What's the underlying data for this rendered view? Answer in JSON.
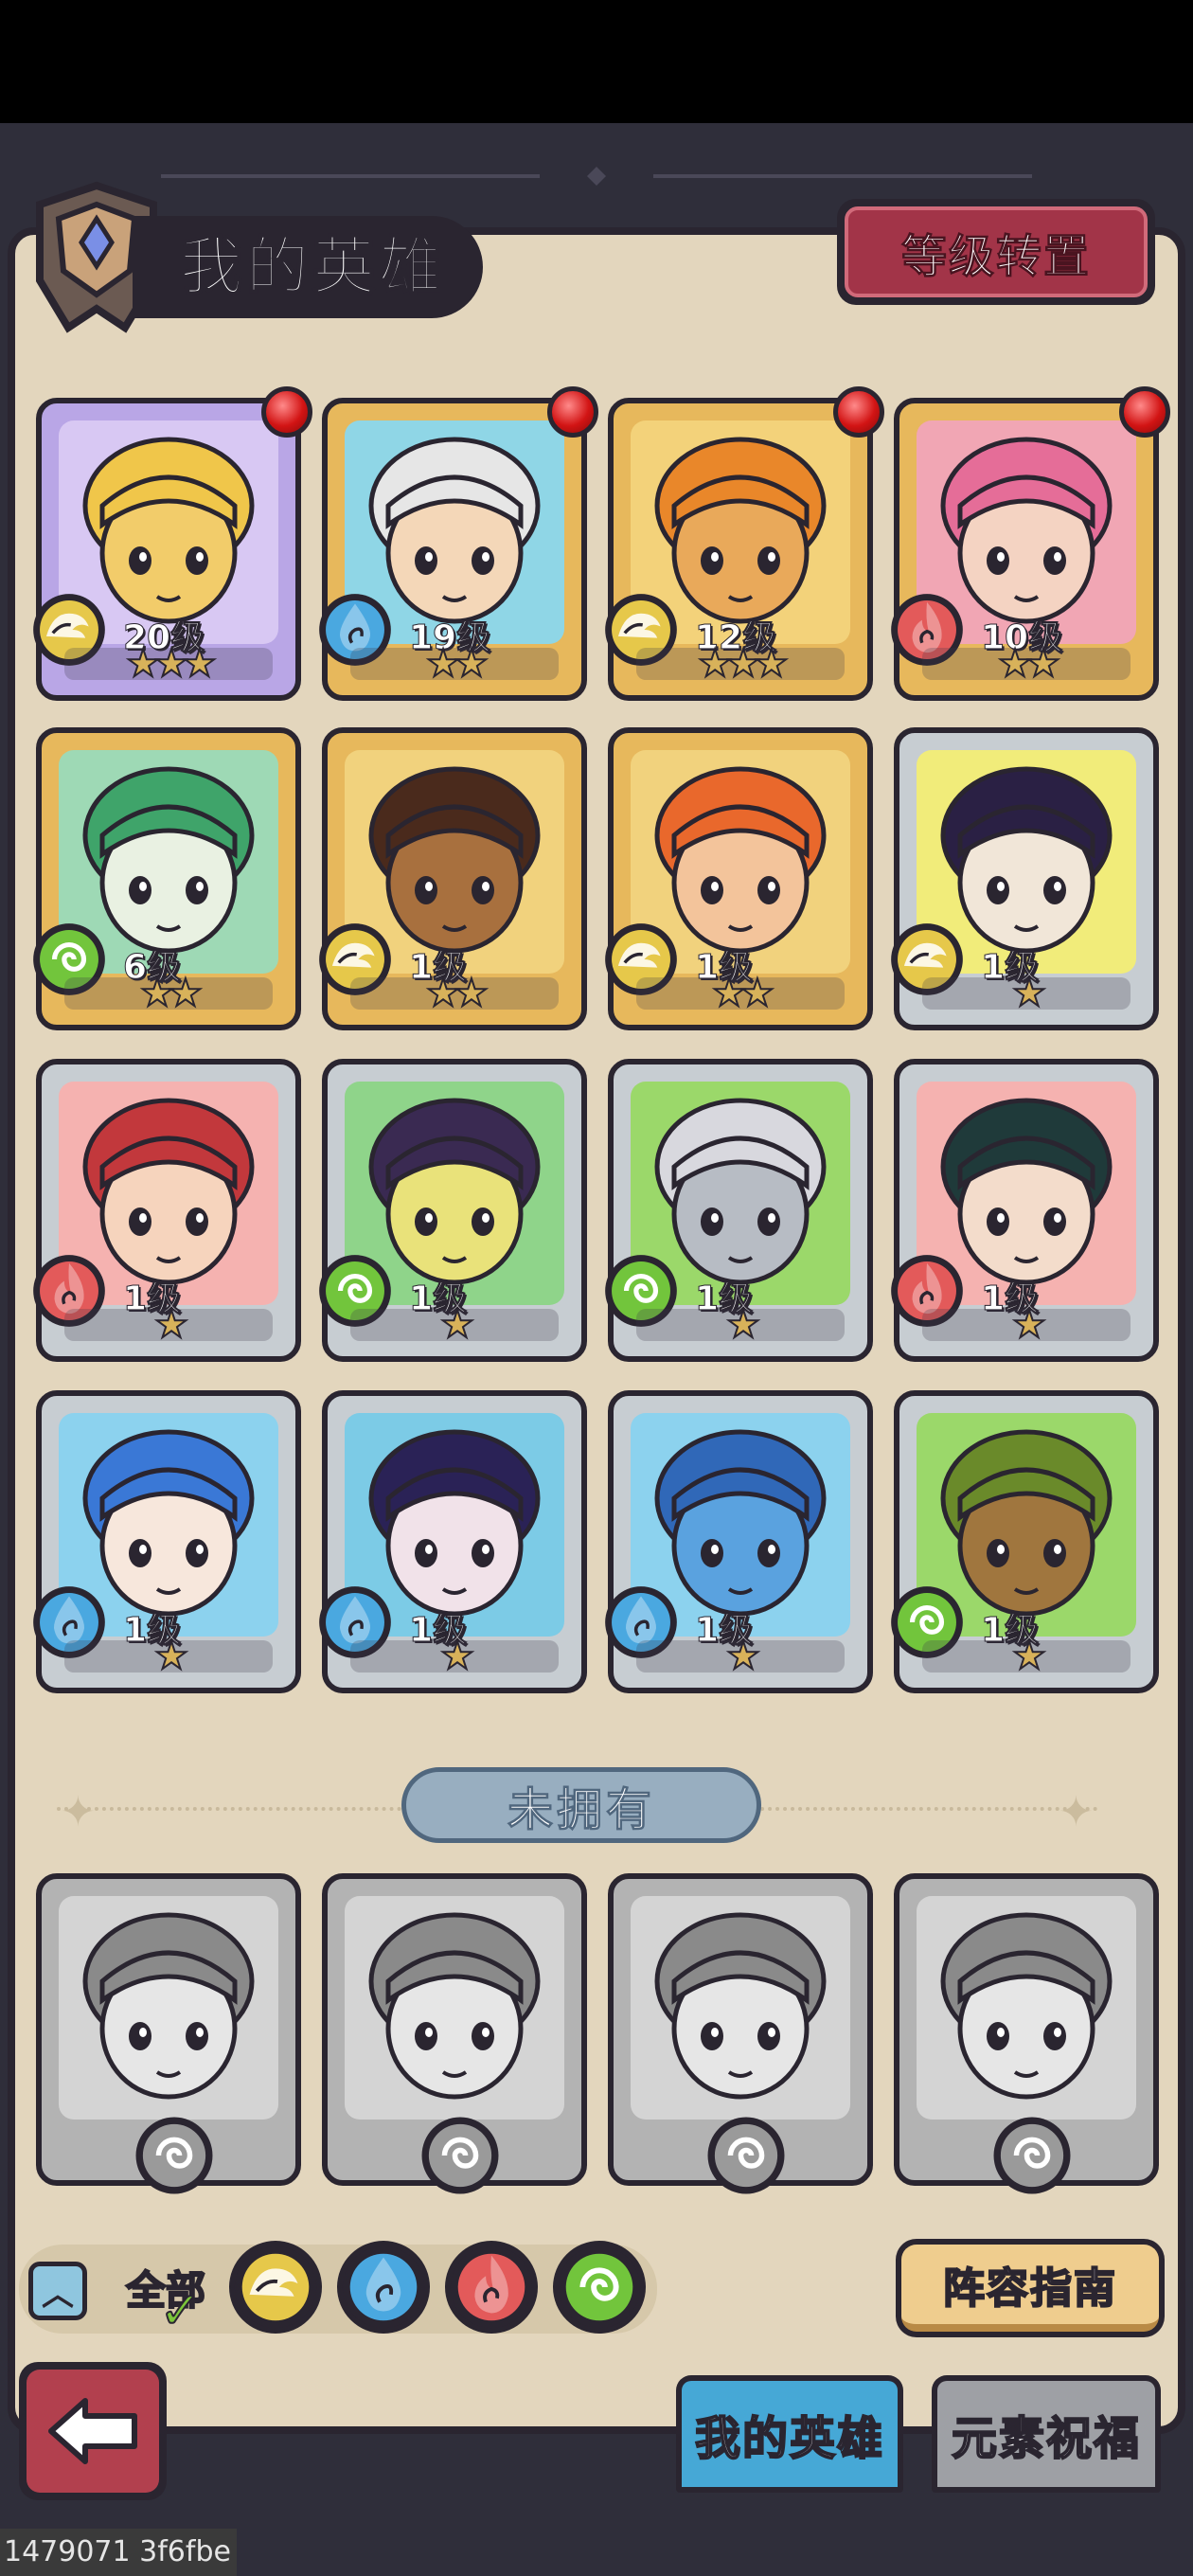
{
  "header": {
    "title": "我的英雄",
    "transfer_button": "等级转置"
  },
  "owned_heroes": [
    {
      "level": "20级",
      "stars": "★★★",
      "element": "earth",
      "tier": "purple",
      "notify": true,
      "skin": "#f2cc6a",
      "hair": "#f0c64a",
      "bg": "#d8c8f3"
    },
    {
      "level": "19级",
      "stars": "★★",
      "element": "water",
      "tier": "gold",
      "notify": true,
      "skin": "#f4d7b8",
      "hair": "#e6e6e6",
      "bg": "#8fd6e6"
    },
    {
      "level": "12级",
      "stars": "★★★",
      "element": "earth",
      "tier": "gold",
      "notify": true,
      "skin": "#e9a95a",
      "hair": "#e9872a",
      "bg": "#f3d27a"
    },
    {
      "level": "10级",
      "stars": "★★",
      "element": "fire",
      "tier": "gold",
      "notify": true,
      "skin": "#f4d3c2",
      "hair": "#e56d98",
      "bg": "#f1a6b4"
    },
    {
      "level": "6级",
      "stars": "★★",
      "element": "wind",
      "tier": "gold",
      "notify": false,
      "skin": "#e9f1e2",
      "hair": "#3fa46a",
      "bg": "#9ed9b5"
    },
    {
      "level": "1级",
      "stars": "★★",
      "element": "earth",
      "tier": "gold",
      "notify": false,
      "skin": "#a8703e",
      "hair": "#4a2a1c",
      "bg": "#f1d27d"
    },
    {
      "level": "1级",
      "stars": "★★",
      "element": "earth",
      "tier": "gold",
      "notify": false,
      "skin": "#f3c49b",
      "hair": "#e9682c",
      "bg": "#f1d27d"
    },
    {
      "level": "1级",
      "stars": "★",
      "element": "earth",
      "tier": "silver",
      "notify": false,
      "skin": "#f1e6d8",
      "hair": "#2a2044",
      "bg": "#f1ec7a"
    },
    {
      "level": "1级",
      "stars": "★",
      "element": "fire",
      "tier": "silver",
      "notify": false,
      "skin": "#f6d4bd",
      "hair": "#c2383c",
      "bg": "#f5b2b0"
    },
    {
      "level": "1级",
      "stars": "★",
      "element": "wind",
      "tier": "silver",
      "notify": false,
      "skin": "#e9e27a",
      "hair": "#3a2a52",
      "bg": "#8fd48a"
    },
    {
      "level": "1级",
      "stars": "★",
      "element": "wind",
      "tier": "silver",
      "notify": false,
      "skin": "#b7bcc4",
      "hair": "#d8d8de",
      "bg": "#9bd86a"
    },
    {
      "level": "1级",
      "stars": "★",
      "element": "fire",
      "tier": "silver",
      "notify": false,
      "skin": "#f3dccb",
      "hair": "#1f3a3a",
      "bg": "#f5b2b0"
    },
    {
      "level": "1级",
      "stars": "★",
      "element": "water",
      "tier": "silver",
      "notify": false,
      "skin": "#f7e7dc",
      "hair": "#3a78d6",
      "bg": "#8cd2ee"
    },
    {
      "level": "1级",
      "stars": "★",
      "element": "water",
      "tier": "silver",
      "notify": false,
      "skin": "#f1e2e9",
      "hair": "#2a2256",
      "bg": "#7ccbe6"
    },
    {
      "level": "1级",
      "stars": "★",
      "element": "water",
      "tier": "silver",
      "notify": false,
      "skin": "#5aa2df",
      "hair": "#3068b8",
      "bg": "#8cd2ee"
    },
    {
      "level": "1级",
      "stars": "★",
      "element": "wind",
      "tier": "silver",
      "notify": false,
      "skin": "#a0763e",
      "hair": "#6a8a2a",
      "bg": "#9bd86a"
    }
  ],
  "unowned_section": {
    "label": "未拥有",
    "heroes": [
      "unknown-hero-shark",
      "unknown-hero-sorceress",
      "unknown-hero-scholar",
      "unknown-hero-elf"
    ]
  },
  "filters": {
    "all_label": "全部",
    "items": [
      "earth",
      "water",
      "fire",
      "wind"
    ]
  },
  "guide_button": "阵容指南",
  "tabs": {
    "my_heroes": "我的英雄",
    "element_blessing": "元素祝福"
  },
  "watermark": "1479071 3f6fbe",
  "colors": {
    "earth": "#e6c84a",
    "water": "#4aa8e0",
    "fire": "#e35a5a",
    "wind": "#72c53c",
    "panel": "#e3d6bd",
    "accent_red": "#a23448"
  }
}
